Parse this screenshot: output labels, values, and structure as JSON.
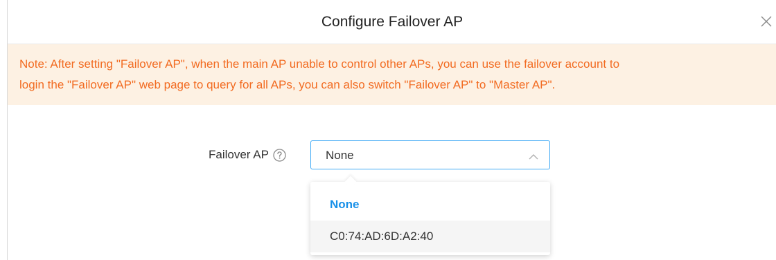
{
  "dialog": {
    "title": "Configure Failover AP",
    "close_icon": "close-icon"
  },
  "note": {
    "line1": "Note: After setting \"Failover AP\", when the main AP unable to control other APs, you can use the failover account to",
    "line2": "login the \"Failover AP\" web page to query for all APs, you can also switch \"Failover AP\" to \"Master AP\"."
  },
  "form": {
    "failover_label": "Failover AP",
    "help_icon": "question-circle-icon",
    "selected_value": "None",
    "chevron_icon": "chevron-up-icon"
  },
  "dropdown": {
    "options": [
      {
        "label": "None",
        "selected": true
      },
      {
        "label": "C0:74:AD:6D:A2:40",
        "selected": false
      }
    ]
  },
  "colors": {
    "note_text": "#f26b21",
    "note_background": "#fdf1e3",
    "accent": "#3fa9f5",
    "selected_option": "#1890e8"
  }
}
